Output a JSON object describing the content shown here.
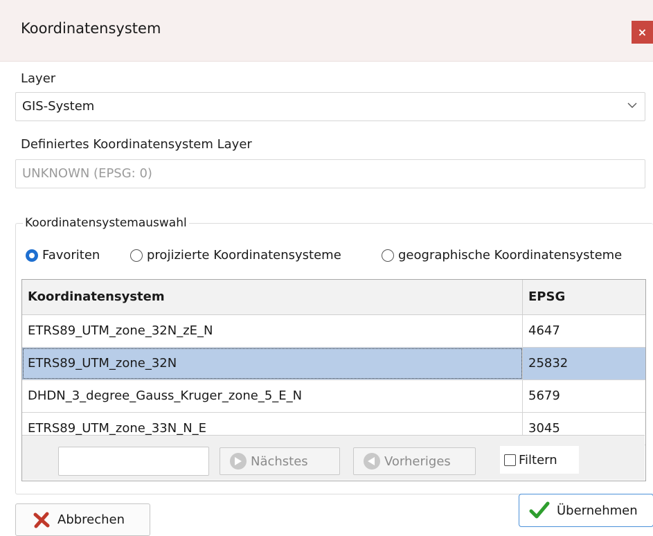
{
  "window": {
    "title": "Koordinatensystem",
    "close_label": "×"
  },
  "layer": {
    "label": "Layer",
    "value": "GIS-System"
  },
  "defined": {
    "label": "Definiertes Koordinatensystem Layer",
    "value": "UNKNOWN (EPSG: 0)"
  },
  "selection": {
    "legend": "Koordinatensystemauswahl",
    "radios": [
      {
        "label": "Favoriten",
        "checked": true
      },
      {
        "label": "projizierte Koordinatensysteme",
        "checked": false
      },
      {
        "label": "geographische Koordinatensysteme",
        "checked": false
      }
    ]
  },
  "table": {
    "headers": [
      "Koordinatensystem",
      "EPSG"
    ],
    "rows": [
      {
        "name": "ETRS89_UTM_zone_32N_zE_N",
        "epsg": "4647",
        "selected": false
      },
      {
        "name": "ETRS89_UTM_zone_32N",
        "epsg": "25832",
        "selected": true
      },
      {
        "name": "DHDN_3_degree_Gauss_Kruger_zone_5_E_N",
        "epsg": "5679",
        "selected": false
      },
      {
        "name": "ETRS89_UTM_zone_33N_N_E",
        "epsg": "3045",
        "selected": false
      }
    ]
  },
  "nav": {
    "search_value": "",
    "next_label": "Nächstes",
    "prev_label": "Vorheriges",
    "filter_label": "Filtern",
    "filter_checked": false
  },
  "actions": {
    "cancel_label": "Abbrechen",
    "apply_label": "Übernehmen"
  },
  "colors": {
    "accent": "#1e6fd0",
    "selection": "#b8cde8",
    "close": "#c9473f",
    "cancel_icon": "#c0392b",
    "apply_icon": "#2e9e2e"
  }
}
